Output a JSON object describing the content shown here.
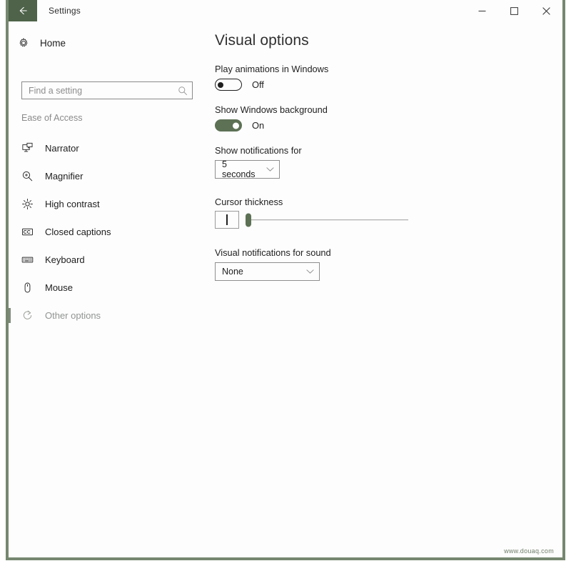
{
  "window": {
    "title": "Settings",
    "back_icon": "back-arrow-icon",
    "controls": {
      "minimize": "minimize-icon",
      "maximize": "maximize-icon",
      "close": "close-icon"
    },
    "accent_color": "#5d7155",
    "titlebar_accent": "#4e6349",
    "border_color": "#76876f"
  },
  "sidebar": {
    "home": {
      "label": "Home",
      "icon": "gear-icon"
    },
    "search": {
      "value": "",
      "placeholder": "Find a setting",
      "icon": "search-icon"
    },
    "section_label": "Ease of Access",
    "items": [
      {
        "label": "Narrator",
        "icon": "narrator-icon",
        "selected": false
      },
      {
        "label": "Magnifier",
        "icon": "magnifier-icon",
        "selected": false
      },
      {
        "label": "High contrast",
        "icon": "brightness-icon",
        "selected": false
      },
      {
        "label": "Closed captions",
        "icon": "closed-captions-icon",
        "selected": false
      },
      {
        "label": "Keyboard",
        "icon": "keyboard-icon",
        "selected": false
      },
      {
        "label": "Mouse",
        "icon": "mouse-icon",
        "selected": false
      },
      {
        "label": "Other options",
        "icon": "other-options-icon",
        "selected": true
      }
    ]
  },
  "main": {
    "title": "Visual options",
    "play_animations": {
      "label": "Play animations in Windows",
      "state_label": "Off",
      "on": false
    },
    "show_background": {
      "label": "Show Windows background",
      "state_label": "On",
      "on": true
    },
    "show_notifications_for": {
      "label": "Show notifications for",
      "value": "5 seconds",
      "chevron": "chevron-down-icon"
    },
    "cursor_thickness": {
      "label": "Cursor thickness",
      "preview_glyph": "cursor-bar",
      "value": 0,
      "min": 0,
      "max": 100
    },
    "visual_notifications_for_sound": {
      "label": "Visual notifications for sound",
      "value": "None",
      "chevron": "chevron-down-icon"
    }
  },
  "watermark": "www.douaq.com"
}
